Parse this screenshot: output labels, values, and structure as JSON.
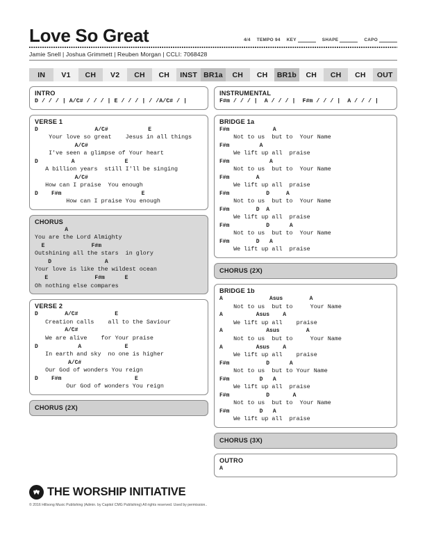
{
  "header": {
    "title": "Love So Great",
    "time_signature": "4/4",
    "tempo_label": "TEMPO 94",
    "key_label": "KEY",
    "shape_label": "SHAPE",
    "capo_label": "CAPO",
    "authors": "Jamie Snell | Joshua Grimmett | Reuben Morgan | CCLI: 7068428"
  },
  "structure": [
    {
      "label": "IN",
      "shade": "sh1"
    },
    {
      "label": "V1",
      "shade": "sh0"
    },
    {
      "label": "CH",
      "shade": "sh1"
    },
    {
      "label": "V2",
      "shade": "sh0"
    },
    {
      "label": "CH",
      "shade": "sh1"
    },
    {
      "label": "CH",
      "shade": "sh0"
    },
    {
      "label": "INST",
      "shade": "sh1"
    },
    {
      "label": "BR1a",
      "shade": "sh2"
    },
    {
      "label": "CH",
      "shade": "sh1"
    },
    {
      "label": "CH",
      "shade": "sh0"
    },
    {
      "label": "BR1b",
      "shade": "sh2"
    },
    {
      "label": "CH",
      "shade": "sh0"
    },
    {
      "label": "CH",
      "shade": "sh1"
    },
    {
      "label": "CH",
      "shade": "sh0"
    },
    {
      "label": "OUT",
      "shade": "sh1"
    }
  ],
  "left_column": {
    "intro": {
      "label": "INTRO",
      "progression": "D / / / | A/C# / / / | E / / / | / /A/C# / |"
    },
    "verse1": {
      "label": "VERSE 1",
      "rows": [
        {
          "type": "chords",
          "text": "D                 A/C#            E"
        },
        {
          "type": "lyrics",
          "text": "    Your love so great    Jesus in all things"
        },
        {
          "type": "chords",
          "text": "            A/C#"
        },
        {
          "type": "lyrics",
          "text": "    I've seen a glimpse of Your heart"
        },
        {
          "type": "chords",
          "text": "D          A               E"
        },
        {
          "type": "lyrics",
          "text": "   A billion years  still I'll be singing"
        },
        {
          "type": "chords",
          "text": "            A/C#"
        },
        {
          "type": "lyrics",
          "text": "   How can I praise  You enough"
        },
        {
          "type": "chords",
          "text": "D    F#m                        E"
        },
        {
          "type": "lyrics",
          "text": "         How can I praise You enough"
        }
      ]
    },
    "chorus": {
      "label": "CHORUS",
      "rows": [
        {
          "type": "chords",
          "text": "         A"
        },
        {
          "type": "lyrics",
          "text": "You are the Lord Almighty"
        },
        {
          "type": "chords",
          "text": "  E              F#m"
        },
        {
          "type": "lyrics",
          "text": "Outshining all the stars  in glory"
        },
        {
          "type": "chords",
          "text": "    D                A"
        },
        {
          "type": "lyrics",
          "text": "Your love is like the wildest ocean"
        },
        {
          "type": "chords",
          "text": "   E              F#m      E"
        },
        {
          "type": "lyrics",
          "text": "Oh nothing else compares"
        }
      ]
    },
    "verse2": {
      "label": "VERSE 2",
      "rows": [
        {
          "type": "chords",
          "text": "D        A/C#           E"
        },
        {
          "type": "lyrics",
          "text": "   Creation calls    all to the Saviour"
        },
        {
          "type": "chords",
          "text": "         A/C#"
        },
        {
          "type": "lyrics",
          "text": "   We are alive    for Your praise"
        },
        {
          "type": "chords",
          "text": "D            A             E"
        },
        {
          "type": "lyrics",
          "text": "   In earth and sky  no one is higher"
        },
        {
          "type": "chords",
          "text": "          A/C#"
        },
        {
          "type": "lyrics",
          "text": "   Our God of wonders You reign"
        },
        {
          "type": "chords",
          "text": "D    F#m                      E"
        },
        {
          "type": "lyrics",
          "text": "         Our God of wonders You reign"
        }
      ]
    },
    "chorus_2x": {
      "label": "CHORUS (2X)"
    }
  },
  "right_column": {
    "instrumental": {
      "label": "INSTRUMENTAL",
      "progression": "F#m / / / |  A / / / |  F#m / / / |  A / / / |"
    },
    "bridge1a": {
      "label": "BRIDGE 1a",
      "rows": [
        {
          "type": "chords",
          "text": "F#m             A"
        },
        {
          "type": "lyrics",
          "text": "    Not to us  but to  Your Name"
        },
        {
          "type": "chords",
          "text": "F#m         A"
        },
        {
          "type": "lyrics",
          "text": "    We lift up all  praise"
        },
        {
          "type": "chords",
          "text": "F#m            A"
        },
        {
          "type": "lyrics",
          "text": "    Not to us  but to  Your Name"
        },
        {
          "type": "chords",
          "text": "F#m        A"
        },
        {
          "type": "lyrics",
          "text": "    We lift up all  praise"
        },
        {
          "type": "chords",
          "text": "F#m           D     A"
        },
        {
          "type": "lyrics",
          "text": "    Not to us  but to  Your Name"
        },
        {
          "type": "chords",
          "text": "F#m        D  A"
        },
        {
          "type": "lyrics",
          "text": "    We lift up all  praise"
        },
        {
          "type": "chords",
          "text": "F#m           D      A"
        },
        {
          "type": "lyrics",
          "text": "    Not to us  but to  Your Name"
        },
        {
          "type": "chords",
          "text": "F#m        D   A"
        },
        {
          "type": "lyrics",
          "text": "    We lift up all  praise"
        }
      ]
    },
    "chorus_2x": {
      "label": "CHORUS (2X)"
    },
    "bridge1b": {
      "label": "BRIDGE 1b",
      "rows": [
        {
          "type": "chords",
          "text": "A              Asus        A"
        },
        {
          "type": "lyrics",
          "text": "    Not to us  but to     Your Name"
        },
        {
          "type": "chords",
          "text": "A          Asus    A"
        },
        {
          "type": "lyrics",
          "text": "    We lift up all    praise"
        },
        {
          "type": "chords",
          "text": "A             Asus        A"
        },
        {
          "type": "lyrics",
          "text": "    Not to us  but to     Your Name"
        },
        {
          "type": "chords",
          "text": "A          Asus    A"
        },
        {
          "type": "lyrics",
          "text": "    We lift up all    praise"
        },
        {
          "type": "chords",
          "text": "F#m           D      A"
        },
        {
          "type": "lyrics",
          "text": "    Not to us  but to Your Name"
        },
        {
          "type": "chords",
          "text": "F#m         D   A"
        },
        {
          "type": "lyrics",
          "text": "    We lift up all  praise"
        },
        {
          "type": "chords",
          "text": "F#m           D       A"
        },
        {
          "type": "lyrics",
          "text": "    Not to us  but to  Your Name"
        },
        {
          "type": "chords",
          "text": "F#m         D   A"
        },
        {
          "type": "lyrics",
          "text": "    We lift up all  praise"
        }
      ]
    },
    "chorus_3x": {
      "label": "CHORUS (3X)"
    },
    "outro": {
      "label": "OUTRO",
      "progression": "A"
    }
  },
  "footer": {
    "brand": "THE WORSHIP INITIATIVE",
    "copyright": "© 2016 Hillsong Music Publishing (Admin. by Capitol CMG Publishing)  All rights reserved. Used by permission.."
  }
}
